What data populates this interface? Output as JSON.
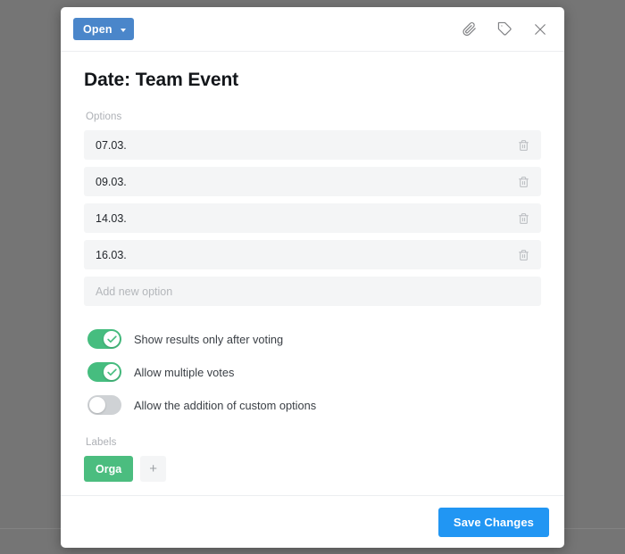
{
  "modal": {
    "header": {
      "status_button": {
        "label": "Open",
        "color": "#4a86ca",
        "caret_icon": "chevron-down-icon"
      },
      "icons": [
        {
          "name": "attachment-icon",
          "glyph": "paperclip"
        },
        {
          "name": "label-tag-icon",
          "glyph": "tag"
        },
        {
          "name": "close-icon",
          "glyph": "x"
        }
      ]
    },
    "title": "Date: Team Event",
    "options_section": {
      "label": "Options",
      "items": [
        {
          "text": "07.03.",
          "delete_icon": "trash-icon"
        },
        {
          "text": "09.03.",
          "delete_icon": "trash-icon"
        },
        {
          "text": "14.03.",
          "delete_icon": "trash-icon"
        },
        {
          "text": "16.03.",
          "delete_icon": "trash-icon"
        }
      ],
      "new_option_placeholder": "Add new option"
    },
    "settings": [
      {
        "label": "Show results only after voting",
        "on": true
      },
      {
        "label": "Allow multiple votes",
        "on": true
      },
      {
        "label": "Allow the addition of custom options",
        "on": false
      }
    ],
    "labels_section": {
      "label": "Labels",
      "chips": [
        {
          "text": "Orga",
          "color": "#4bbd7f"
        }
      ],
      "add_label": "+"
    },
    "footer": {
      "save_label": "Save Changes",
      "save_color": "#2196f3"
    }
  },
  "backdrop": {
    "color": "#757575"
  }
}
